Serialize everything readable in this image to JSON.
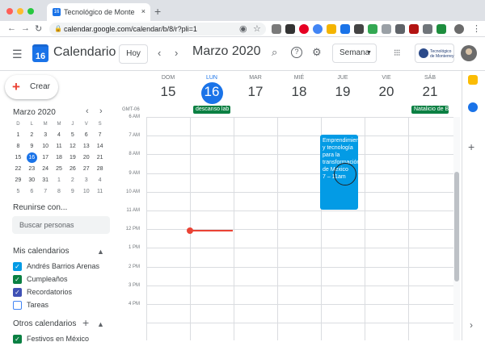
{
  "browser": {
    "tab_title": "Tecnológico de Monterrey: Calen",
    "tab_close": "×",
    "new_tab": "+",
    "url": "calendar.google.com/calendar/b/8/r?pli=1",
    "favicon": "16",
    "nav": {
      "back": "←",
      "forward": "→",
      "reload": "↻"
    }
  },
  "header": {
    "menu_icon": "☰",
    "logo_day": "16",
    "app_title": "Calendario",
    "today_label": "Hoy",
    "prev": "‹",
    "next": "›",
    "month_title": "Marzo 2020",
    "search_icon": "⌕",
    "help_icon": "?",
    "settings_icon": "⚙",
    "view_label": "Semana",
    "view_caret": "▼",
    "apps_icon": "⋮⋮⋮",
    "org_name": "Tecnológico de Monterrey"
  },
  "sidebar": {
    "create_label": "Crear",
    "create_icon": "+",
    "mini_title": "Marzo 2020",
    "mini_prev": "‹",
    "mini_next": "›",
    "weekday_headers": [
      "D",
      "L",
      "M",
      "M",
      "J",
      "V",
      "S"
    ],
    "weeks": [
      [
        "1",
        "2",
        "3",
        "4",
        "5",
        "6",
        "7"
      ],
      [
        "8",
        "9",
        "10",
        "11",
        "12",
        "13",
        "14"
      ],
      [
        "15",
        "16",
        "17",
        "18",
        "19",
        "20",
        "21"
      ],
      [
        "22",
        "23",
        "24",
        "25",
        "26",
        "27",
        "28"
      ],
      [
        "29",
        "30",
        "31",
        "1",
        "2",
        "3",
        "4"
      ],
      [
        "5",
        "6",
        "7",
        "8",
        "9",
        "10",
        "11"
      ]
    ],
    "selected_day": "16",
    "meet_title": "Reunirse con...",
    "people_placeholder": "Buscar personas",
    "my_calendars_title": "Mis calendarios",
    "my_calendars": [
      {
        "label": "Andrés Barrios Arenas",
        "color": "#039be5",
        "checked": true
      },
      {
        "label": "Cumpleaños",
        "color": "#0b8043",
        "checked": true
      },
      {
        "label": "Recordatorios",
        "color": "#3f51b5",
        "checked": true
      },
      {
        "label": "Tareas",
        "color": "#4285f4",
        "checked": false
      }
    ],
    "other_calendars_title": "Otros calendarios",
    "other_add": "+",
    "other_calendars": [
      {
        "label": "Festivos en México",
        "color": "#0b8043",
        "checked": true
      }
    ],
    "caret_up": "▲"
  },
  "week": {
    "timezone": "GMT-06",
    "days": [
      {
        "name": "DOM",
        "num": "15"
      },
      {
        "name": "LUN",
        "num": "16"
      },
      {
        "name": "MAR",
        "num": "17"
      },
      {
        "name": "MIÉ",
        "num": "18"
      },
      {
        "name": "JUE",
        "num": "19"
      },
      {
        "name": "VIE",
        "num": "20"
      },
      {
        "name": "SÁB",
        "num": "21"
      }
    ],
    "allday_events": [
      {
        "day": 1,
        "title": "descanso lab"
      },
      {
        "day": 6,
        "title": "Natalicio de B"
      }
    ],
    "hours": [
      "6 AM",
      "7 AM",
      "8 AM",
      "9 AM",
      "10 AM",
      "11 AM",
      "12 PM",
      "1 PM",
      "2 PM",
      "3 PM",
      "4 PM"
    ],
    "event": {
      "title": "Emprendimiento y tecnología para la transformación de México",
      "time": "7 – 11am"
    }
  },
  "side_panel": {
    "add": "+",
    "expand": "›"
  },
  "colors": {
    "accent": "#1a73e8",
    "now_line": "#ea4335",
    "event": "#039be5",
    "holiday": "#0b8043"
  }
}
